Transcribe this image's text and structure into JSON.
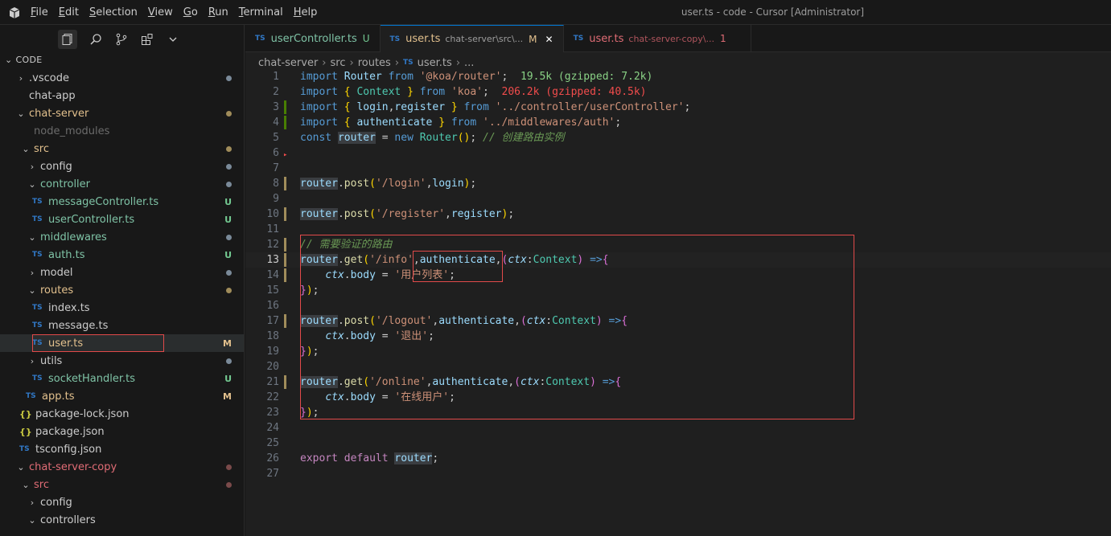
{
  "window": {
    "title": "user.ts - code - Cursor [Administrator]"
  },
  "menu": [
    "File",
    "Edit",
    "Selection",
    "View",
    "Go",
    "Run",
    "Terminal",
    "Help"
  ],
  "explorer": {
    "title": "CODE"
  },
  "tree": [
    {
      "label": ".vscode",
      "indent": 20,
      "chev": "›",
      "dot": "#7a8a99"
    },
    {
      "label": "chat-app",
      "indent": 20,
      "chev": ""
    },
    {
      "label": "chat-server",
      "indent": 20,
      "chev": "⌄",
      "color": "#e2c08d",
      "dot": "#a08c5a"
    },
    {
      "label": "node_modules",
      "indent": 26,
      "chev": "",
      "color": "#6b6b6b"
    },
    {
      "label": "src",
      "indent": 26,
      "chev": "⌄",
      "color": "#e2c08d",
      "dot": "#a08c5a"
    },
    {
      "label": "config",
      "indent": 34,
      "chev": "›",
      "dot": "#7a8a99"
    },
    {
      "label": "controller",
      "indent": 34,
      "chev": "⌄",
      "color": "#7fc3a6",
      "dot": "#7a8a99"
    },
    {
      "label": "messageController.ts",
      "indent": 40,
      "icon": "TS",
      "color": "#7fc3a6",
      "badge": "U",
      "badgeColor": "#73c991"
    },
    {
      "label": "userController.ts",
      "indent": 40,
      "icon": "TS",
      "color": "#7fc3a6",
      "badge": "U",
      "badgeColor": "#73c991"
    },
    {
      "label": "middlewares",
      "indent": 34,
      "chev": "⌄",
      "color": "#7fc3a6",
      "dot": "#7a8a99"
    },
    {
      "label": "auth.ts",
      "indent": 40,
      "icon": "TS",
      "color": "#7fc3a6",
      "badge": "U",
      "badgeColor": "#73c991"
    },
    {
      "label": "model",
      "indent": 34,
      "chev": "›",
      "dot": "#7a8a99"
    },
    {
      "label": "routes",
      "indent": 34,
      "chev": "⌄",
      "color": "#e2c08d",
      "dot": "#a08c5a"
    },
    {
      "label": "index.ts",
      "indent": 40,
      "icon": "TS",
      "color": "#cccccc"
    },
    {
      "label": "message.ts",
      "indent": 40,
      "icon": "TS",
      "color": "#cccccc"
    },
    {
      "label": "user.ts",
      "indent": 40,
      "icon": "TS",
      "color": "#e2c08d",
      "badge": "M",
      "badgeColor": "#e2c08d",
      "selected": true
    },
    {
      "label": "utils",
      "indent": 34,
      "chev": "›",
      "dot": "#7a8a99"
    },
    {
      "label": "socketHandler.ts",
      "indent": 40,
      "icon": "TS",
      "color": "#7fc3a6",
      "badge": "U",
      "badgeColor": "#73c991"
    },
    {
      "label": "app.ts",
      "indent": 32,
      "icon": "TS",
      "color": "#e2c08d",
      "badge": "M",
      "badgeColor": "#e2c08d"
    },
    {
      "label": "package-lock.json",
      "indent": 24,
      "icon": "{}",
      "color": "#cccccc"
    },
    {
      "label": "package.json",
      "indent": 24,
      "icon": "{}",
      "color": "#cccccc"
    },
    {
      "label": "tsconfig.json",
      "indent": 24,
      "icon": "TS",
      "color": "#cccccc"
    },
    {
      "label": "chat-server-copy",
      "indent": 20,
      "chev": "⌄",
      "color": "#e06c75",
      "dot": "#7a4a4a"
    },
    {
      "label": "src",
      "indent": 26,
      "chev": "⌄",
      "color": "#e06c75",
      "dot": "#7a4a4a"
    },
    {
      "label": "config",
      "indent": 34,
      "chev": "›"
    },
    {
      "label": "controllers",
      "indent": 34,
      "chev": "⌄"
    }
  ],
  "tabs": [
    {
      "name": "userController.ts",
      "status": "U",
      "desc": ""
    },
    {
      "name": "user.ts",
      "desc": "chat-server\\src\\...",
      "status": "M",
      "active": true,
      "close": "✕"
    },
    {
      "name": "user.ts",
      "desc": "chat-server-copy\\...",
      "status": "1"
    }
  ],
  "breadcrumb": [
    "chat-server",
    "src",
    "routes",
    "user.ts",
    "..."
  ],
  "code": {
    "line1": {
      "a": "import",
      "b": " Router ",
      "c": "from",
      "d": " '@koa/router'",
      "e": ";",
      "size": "19.5k (gzipped: 7.2k)"
    },
    "line2": {
      "size": "206.2k (gzipped: 40.5k)"
    },
    "comment5": "// 创建路由实例",
    "comment12": "// 需要验证的路由",
    "str13": "'用户列表'",
    "str17": "'退出'",
    "str21": "'在线用户'"
  }
}
